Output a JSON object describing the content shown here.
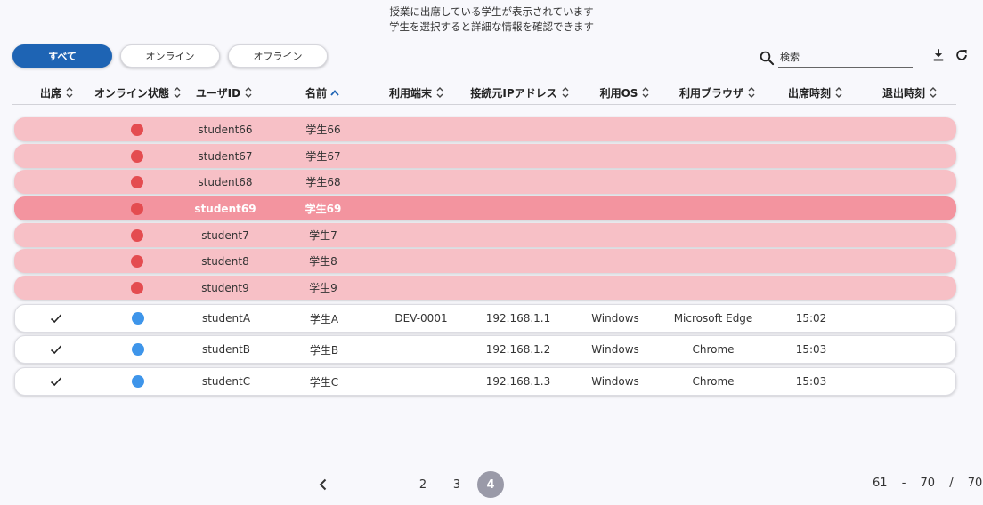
{
  "header": {
    "line1": "授業に出席している学生が表示されています",
    "line2": "学生を選択すると詳細な情報を確認できます"
  },
  "filters": {
    "all": "すべて",
    "online": "オンライン",
    "offline": "オフライン",
    "selected": "すべて"
  },
  "search": {
    "placeholder": "検索",
    "value": ""
  },
  "columns": [
    "出席",
    "オンライン状態",
    "ユーザID",
    "名前",
    "利用端末",
    "接続元IPアドレス",
    "利用OS",
    "利用ブラウザ",
    "出席時刻",
    "退出時刻"
  ],
  "sort": {
    "column": "名前",
    "direction": "ascending"
  },
  "rows": [
    {
      "attended": false,
      "status": "offline",
      "user_id": "student66",
      "name": "学生66",
      "device": "",
      "ip": "",
      "os": "",
      "browser": "",
      "in": "",
      "out": ""
    },
    {
      "attended": false,
      "status": "offline",
      "user_id": "student67",
      "name": "学生67",
      "device": "",
      "ip": "",
      "os": "",
      "browser": "",
      "in": "",
      "out": ""
    },
    {
      "attended": false,
      "status": "offline",
      "user_id": "student68",
      "name": "学生68",
      "device": "",
      "ip": "",
      "os": "",
      "browser": "",
      "in": "",
      "out": ""
    },
    {
      "attended": false,
      "status": "offline",
      "user_id": "student69",
      "name": "学生69",
      "device": "",
      "ip": "",
      "os": "",
      "browser": "",
      "in": "",
      "out": "",
      "selected": true
    },
    {
      "attended": false,
      "status": "offline",
      "user_id": "student7",
      "name": "学生7",
      "device": "",
      "ip": "",
      "os": "",
      "browser": "",
      "in": "",
      "out": ""
    },
    {
      "attended": false,
      "status": "offline",
      "user_id": "student8",
      "name": "学生8",
      "device": "",
      "ip": "",
      "os": "",
      "browser": "",
      "in": "",
      "out": ""
    },
    {
      "attended": false,
      "status": "offline",
      "user_id": "student9",
      "name": "学生9",
      "device": "",
      "ip": "",
      "os": "",
      "browser": "",
      "in": "",
      "out": ""
    },
    {
      "attended": true,
      "status": "online",
      "user_id": "studentA",
      "name": "学生A",
      "device": "DEV-0001",
      "ip": "192.168.1.1",
      "os": "Windows",
      "browser": "Microsoft Edge",
      "in": "15:02",
      "out": ""
    },
    {
      "attended": true,
      "status": "online",
      "user_id": "studentB",
      "name": "学生B",
      "device": "",
      "ip": "192.168.1.2",
      "os": "Windows",
      "browser": "Chrome",
      "in": "15:03",
      "out": ""
    },
    {
      "attended": true,
      "status": "online",
      "user_id": "studentC",
      "name": "学生C",
      "device": "",
      "ip": "192.168.1.3",
      "os": "Windows",
      "browser": "Chrome",
      "in": "15:03",
      "out": ""
    }
  ],
  "pagination": {
    "pages": [
      "2",
      "3",
      "4"
    ],
    "current": "4",
    "range_start": "61",
    "range_dash": "-",
    "range_end": "70",
    "slash": "/",
    "total": "70"
  },
  "colors": {
    "accent": "#1e64b4",
    "offline_row": "#f7c0c6",
    "selected_row": "#f3949f",
    "offline_dot": "#e44c50",
    "online_dot": "#3e95ea",
    "current_page": "#9a9aa8"
  },
  "icons": {
    "search": "search-icon",
    "download": "download-icon",
    "refresh": "refresh-icon",
    "sort": "sort-icon",
    "sort_asc": "sort-ascending-icon",
    "check": "check-icon",
    "prev": "chevron-left-icon"
  }
}
